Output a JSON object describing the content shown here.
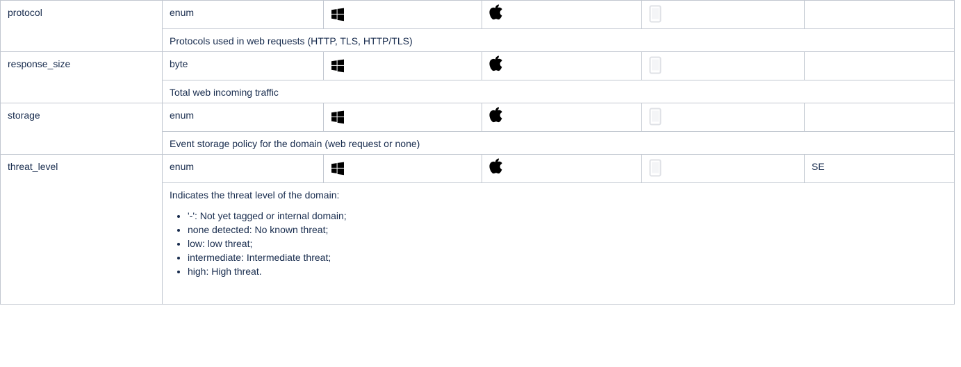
{
  "colors": {
    "border": "#c1c7d0",
    "text": "#172b4d",
    "os_icon": "#000000",
    "mobile_icon": "#dfe1e6"
  },
  "icons": {
    "windows": "windows-icon",
    "apple": "apple-icon",
    "mobile": "mobile-device-icon"
  },
  "rows": [
    {
      "name": "protocol",
      "type": "enum",
      "extra": "",
      "description": "Protocols used in web requests (HTTP, TLS, HTTP/TLS)"
    },
    {
      "name": "response_size",
      "type": "byte",
      "extra": "",
      "description": "Total web incoming traffic"
    },
    {
      "name": "storage",
      "type": "enum",
      "extra": "",
      "description": "Event storage policy for the domain (web request or none)"
    },
    {
      "name": "threat_level",
      "type": "enum",
      "extra": "SE",
      "description": "Indicates the threat level of the domain:",
      "description_items": [
        "'-': Not yet tagged or internal domain;",
        "none detected: No known threat;",
        "low: low threat;",
        "intermediate: Intermediate threat;",
        "high: High threat."
      ]
    }
  ]
}
